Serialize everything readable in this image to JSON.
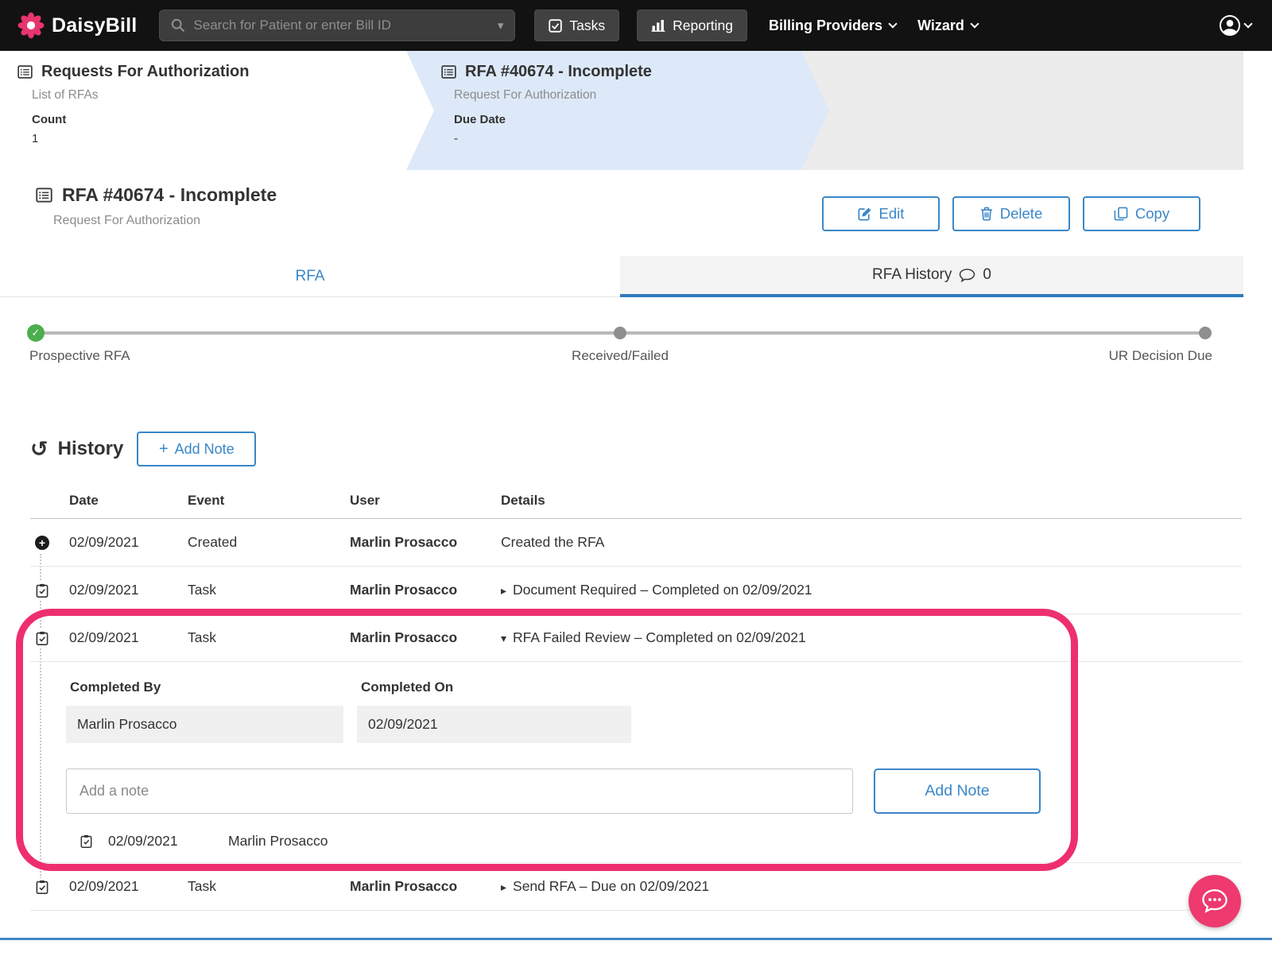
{
  "colors": {
    "brand_pink": "#e8356d",
    "accent_blue": "#3a87c8",
    "tab_underline_blue": "#2e7abf",
    "success_green": "#4cae4c",
    "annotation_pink": "#ee2f6f",
    "nav_background": "#121212"
  },
  "nav": {
    "brand": "DaisyBill",
    "search": {
      "placeholder": "Search for Patient or enter Bill ID"
    },
    "tasks": "Tasks",
    "reporting": "Reporting",
    "billing_providers": "Billing Providers",
    "wizard": "Wizard"
  },
  "breadcrumbs": {
    "rfa_list": {
      "title": "Requests For Authorization",
      "subtitle": "List of RFAs",
      "count_label": "Count",
      "count_value": "1"
    },
    "rfa": {
      "title": "RFA #40674 - Incomplete",
      "subtitle": "Request For Authorization",
      "due_label": "Due Date",
      "due_value": "-"
    }
  },
  "header": {
    "title": "RFA #40674 - Incomplete",
    "subtitle": "Request For Authorization",
    "edit": "Edit",
    "delete": "Delete",
    "copy": "Copy"
  },
  "tabs": {
    "rfa": "RFA",
    "history": "RFA History",
    "history_count": "0"
  },
  "progress": {
    "steps": [
      {
        "label": "Prospective RFA",
        "state": "complete"
      },
      {
        "label": "Received/Failed",
        "state": "pending"
      },
      {
        "label": "UR Decision Due",
        "state": "pending"
      }
    ]
  },
  "history": {
    "heading": "History",
    "add_note": "Add Note",
    "table": {
      "headers": [
        "Date",
        "Event",
        "User",
        "Details"
      ],
      "rows": [
        {
          "date": "02/09/2021",
          "event": "Created",
          "user": "Marlin Prosacco",
          "details": "Created the RFA"
        },
        {
          "date": "02/09/2021",
          "event": "Task",
          "user": "Marlin Prosacco",
          "details": "Document Required – Completed on 02/09/2021"
        },
        {
          "date": "02/09/2021",
          "event": "Task",
          "user": "Marlin Prosacco",
          "details": "RFA Failed Review – Completed on 02/09/2021",
          "expanded": {
            "completed_by_label": "Completed By",
            "completed_by_value": "Marlin Prosacco",
            "completed_on_label": "Completed On",
            "completed_on_value": "02/09/2021",
            "note_placeholder": "Add a note",
            "add_note_button": "Add Note",
            "note_date": "02/09/2021",
            "note_user": "Marlin Prosacco"
          }
        },
        {
          "date": "02/09/2021",
          "event": "Task",
          "user": "Marlin Prosacco",
          "details": "Send RFA – Due on 02/09/2021"
        }
      ]
    }
  }
}
